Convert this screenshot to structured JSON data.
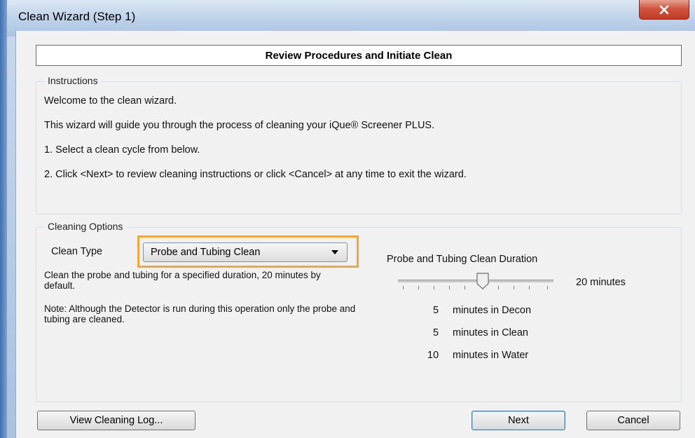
{
  "window": {
    "title": "Clean Wizard (Step 1)",
    "close_icon": "close-icon"
  },
  "header": {
    "title": "Review Procedures and Initiate Clean"
  },
  "instructions": {
    "legend": "Instructions",
    "lines": [
      "Welcome to the clean wizard.",
      "This wizard will guide you through the process of cleaning your iQue® Screener PLUS.",
      "1.  Select a clean cycle from below.",
      "2.  Click <Next> to review cleaning instructions or click <Cancel> at any time to exit the wizard."
    ]
  },
  "cleaning_options": {
    "legend": "Cleaning Options",
    "clean_type_label": "Clean Type",
    "clean_type_value": "Probe and Tubing Clean",
    "description": "Clean the probe and tubing for a specified duration, 20 minutes by default.",
    "note": "Note: Although the Detector is run during this operation only the probe and tubing are cleaned.",
    "duration_title": "Probe and Tubing Clean Duration",
    "duration_value": "20 minutes",
    "slider_fraction": 0.5,
    "breakdown": [
      {
        "minutes": "5",
        "label": "minutes in Decon"
      },
      {
        "minutes": "5",
        "label": "minutes in Clean"
      },
      {
        "minutes": "10",
        "label": "minutes in Water"
      }
    ]
  },
  "buttons": {
    "view_log": "View Cleaning Log...",
    "next": "Next",
    "cancel": "Cancel"
  },
  "colors": {
    "highlight": "#f0a83a",
    "close_button": "#c13a24",
    "title_bar": "#bcd1ea"
  }
}
